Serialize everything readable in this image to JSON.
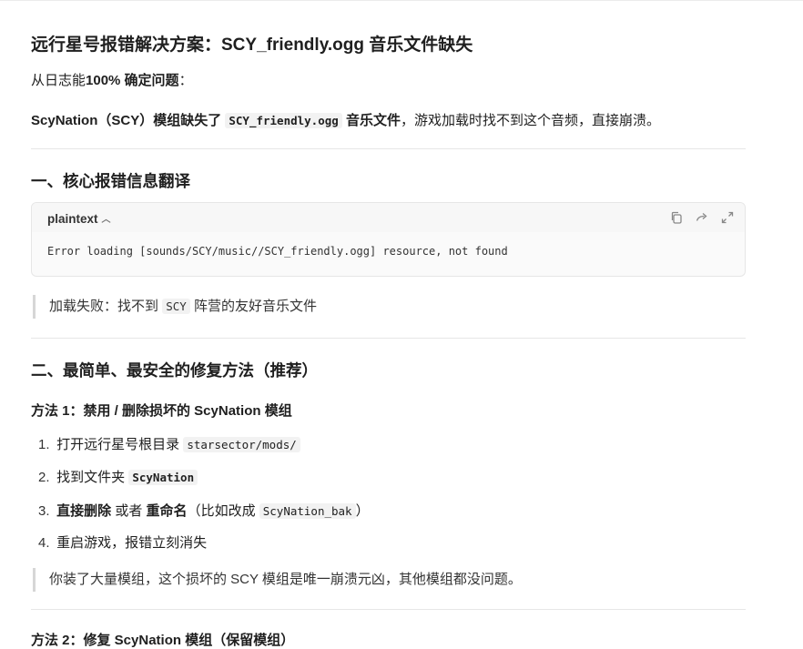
{
  "title": "远行星号报错解决方案：SCY_friendly.ogg 音乐文件缺失",
  "intro": {
    "prefix": "从日志能",
    "bold": "100% 确定问题",
    "suffix": "："
  },
  "summary": {
    "part1_bold": "ScyNation（SCY）模组缺失了",
    "code": "SCY_friendly.ogg",
    "part2_bold": "音乐文件",
    "part3": "，游戏加载时找不到这个音频，直接崩溃。"
  },
  "section1": {
    "heading": "一、核心报错信息翻译",
    "codeblock": {
      "language": "plaintext",
      "code": "Error loading [sounds/SCY/music//SCY_friendly.ogg] resource, not found",
      "icons": [
        "copy-icon",
        "share-icon",
        "expand-icon"
      ]
    },
    "quote": {
      "prefix": "加载失败：找不到",
      "code": "SCY",
      "suffix": "阵营的友好音乐文件"
    }
  },
  "section2": {
    "heading": "二、最简单、最安全的修复方法（推荐）",
    "method1": {
      "heading": "方法 1：禁用 / 删除损坏的 ScyNation 模组",
      "steps": [
        {
          "num": "1.",
          "text": "打开远行星号根目录",
          "code": "starsector/mods/"
        },
        {
          "num": "2.",
          "text": "找到文件夹",
          "code": "ScyNation"
        },
        {
          "num": "3.",
          "bold1": "直接删除",
          "mid": "或者",
          "bold2": "重命名",
          "pre": "（比如改成",
          "code": "ScyNation_bak",
          "post": "）"
        },
        {
          "num": "4.",
          "text": "重启游戏，报错立刻消失"
        }
      ],
      "quote": "你装了大量模组，这个损坏的 SCY 模组是唯一崩溃元凶，其他模组都没问题。"
    },
    "method2": {
      "heading": "方法 2：修复 ScyNation 模组（保留模组）"
    }
  }
}
